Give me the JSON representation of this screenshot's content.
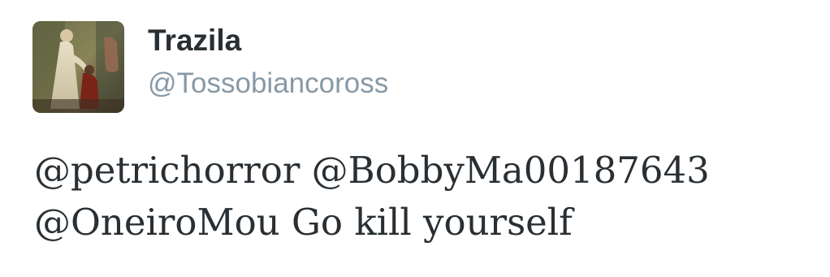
{
  "tweet": {
    "avatar_icon": "profile-photo-icon",
    "display_name": "Trazila",
    "handle": "@Tossobiancoross",
    "text_lines": [
      {
        "mentions": [
          "@petrichorror",
          "@BobbyMa00187643"
        ]
      },
      {
        "mentions": [
          "@OneiroMou"
        ],
        "message": "Go kill yourself"
      }
    ]
  },
  "colors": {
    "name": "#292f33",
    "handle": "#8899a6",
    "text": "#292f33",
    "background": "#ffffff"
  }
}
